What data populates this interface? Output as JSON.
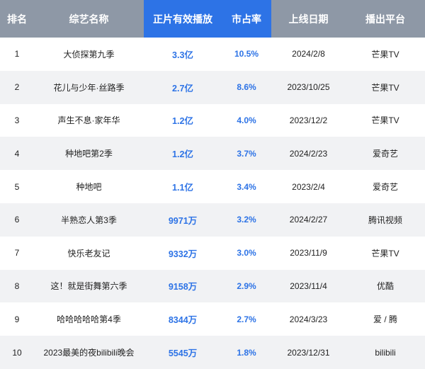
{
  "headers": {
    "rank": "排名",
    "name": "综艺名称",
    "plays": "正片有效播放",
    "share": "市占率",
    "date": "上线日期",
    "platform": "播出平台"
  },
  "rows": [
    {
      "rank": "1",
      "name": "大侦探第九季",
      "plays": "3.3亿",
      "share": "10.5%",
      "date": "2024/2/8",
      "platform": "芒果TV"
    },
    {
      "rank": "2",
      "name": "花儿与少年·丝路季",
      "plays": "2.7亿",
      "share": "8.6%",
      "date": "2023/10/25",
      "platform": "芒果TV"
    },
    {
      "rank": "3",
      "name": "声生不息·家年华",
      "plays": "1.2亿",
      "share": "4.0%",
      "date": "2023/12/2",
      "platform": "芒果TV"
    },
    {
      "rank": "4",
      "name": "种地吧第2季",
      "plays": "1.2亿",
      "share": "3.7%",
      "date": "2024/2/23",
      "platform": "爱奇艺"
    },
    {
      "rank": "5",
      "name": "种地吧",
      "plays": "1.1亿",
      "share": "3.4%",
      "date": "2023/2/4",
      "platform": "爱奇艺"
    },
    {
      "rank": "6",
      "name": "半熟恋人第3季",
      "plays": "9971万",
      "share": "3.2%",
      "date": "2024/2/27",
      "platform": "腾讯视频"
    },
    {
      "rank": "7",
      "name": "快乐老友记",
      "plays": "9332万",
      "share": "3.0%",
      "date": "2023/11/9",
      "platform": "芒果TV"
    },
    {
      "rank": "8",
      "name": "这！就是街舞第六季",
      "plays": "9158万",
      "share": "2.9%",
      "date": "2023/11/4",
      "platform": "优酷"
    },
    {
      "rank": "9",
      "name": "哈哈哈哈哈第4季",
      "plays": "8344万",
      "share": "2.7%",
      "date": "2024/3/23",
      "platform": "爱 / 腾"
    },
    {
      "rank": "10",
      "name": "2023最美的夜bilibili晚会",
      "plays": "5545万",
      "share": "1.8%",
      "date": "2023/12/31",
      "platform": "bilibili"
    }
  ],
  "colors": {
    "header_bg": "#8e98a6",
    "header_highlight": "#2d73e6",
    "value_text": "#2d73e6",
    "stripe": "#f1f2f4"
  }
}
